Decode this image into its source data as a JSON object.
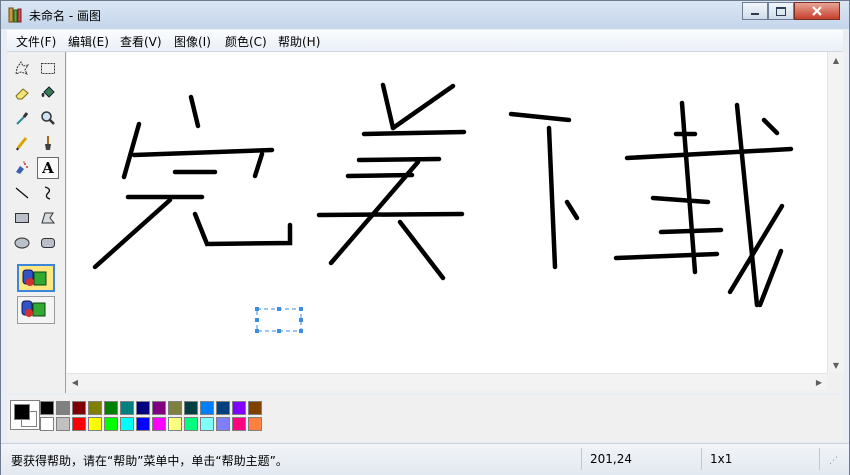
{
  "window": {
    "title": "未命名 - 画图"
  },
  "title_buttons": [
    {
      "name": "minimize-button",
      "icon": "minimize-icon"
    },
    {
      "name": "maximize-button",
      "icon": "maximize-icon"
    },
    {
      "name": "close-button",
      "icon": "close-icon"
    }
  ],
  "menu": [
    "文件(F)",
    "编辑(E)",
    "查看(V)",
    "图像(I)",
    "颜色(C)",
    "帮助(H)"
  ],
  "tools": [
    "free-form-select-icon",
    "rect-select-icon",
    "eraser-icon",
    "fill-icon",
    "eyedropper-icon",
    "magnifier-icon",
    "pencil-icon",
    "brush-icon",
    "airbrush-icon",
    "text-icon",
    "line-icon",
    "curve-icon",
    "rectangle-icon",
    "polygon-icon",
    "ellipse-icon",
    "rounded-rect-icon"
  ],
  "selected_tool": "text-icon",
  "text_tool_glyph": "A",
  "palette": {
    "foreground": "#000000",
    "background": "#ffffff",
    "top_row": [
      "#000000",
      "#808080",
      "#800000",
      "#808000",
      "#008000",
      "#008080",
      "#000080",
      "#800080",
      "#808040",
      "#004040",
      "#0080ff",
      "#004080",
      "#8000ff",
      "#804000"
    ],
    "bottom_row": [
      "#ffffff",
      "#c0c0c0",
      "#ff0000",
      "#ffff00",
      "#00ff00",
      "#00ffff",
      "#0000ff",
      "#ff00ff",
      "#ffff80",
      "#00ff80",
      "#80ffff",
      "#8080ff",
      "#ff0080",
      "#ff8040"
    ]
  },
  "status": {
    "help": "要获得帮助，请在“帮助”菜单中，单击“帮助主题”。",
    "coords": "201,24",
    "size": "1x1"
  }
}
